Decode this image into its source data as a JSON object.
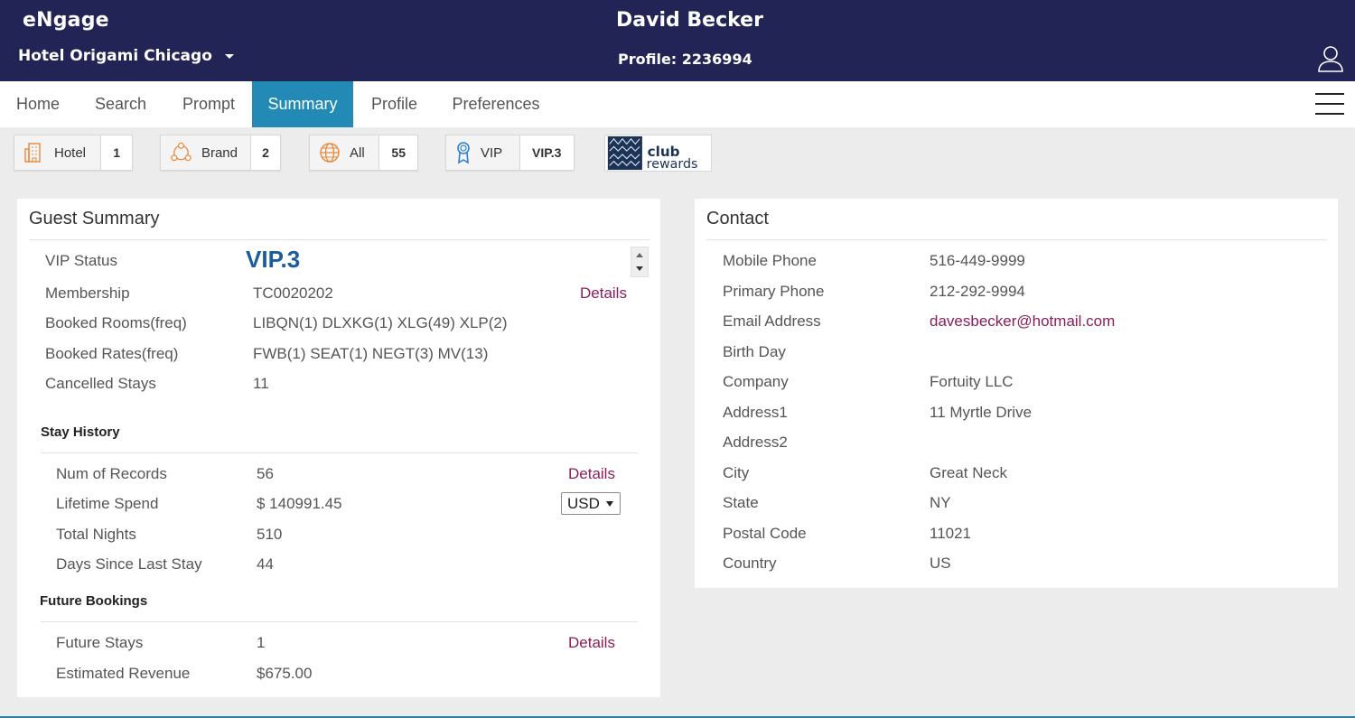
{
  "header": {
    "app_title": "eNgage",
    "hotel": "Hotel Origami Chicago",
    "guest_name": "David Becker",
    "profile": "Profile: 2236994"
  },
  "nav": {
    "tabs": [
      "Home",
      "Search",
      "Prompt",
      "Summary",
      "Profile",
      "Preferences"
    ],
    "active": "Summary"
  },
  "badges": [
    {
      "label": "Hotel",
      "value": "1",
      "icon": "hotel-building-icon"
    },
    {
      "label": "Brand",
      "value": "2",
      "icon": "brand-network-icon"
    },
    {
      "label": "All",
      "value": "55",
      "icon": "globe-icon"
    },
    {
      "label": "VIP",
      "value": "VIP.3",
      "icon": "ribbon-award-icon"
    }
  ],
  "club_logo": {
    "line1": "club",
    "line2": "rewards"
  },
  "guest_summary": {
    "title": "Guest Summary",
    "vip_label": "VIP Status",
    "vip_value": "VIP.3",
    "membership_label": "Membership",
    "membership_value": "TC0020202",
    "details_label": "Details",
    "rooms_label": "Booked Rooms(freq)",
    "rooms_value": "LIBQN(1) DLXKG(1) XLG(49) XLP(2)",
    "rates_label": "Booked Rates(freq)",
    "rates_value": "FWB(1) SEAT(1) NEGT(3) MV(13)",
    "cancelled_label": "Cancelled Stays",
    "cancelled_value": "11"
  },
  "stay_history": {
    "title": "Stay History",
    "records_label": "Num of Records",
    "records_value": "56",
    "details_label": "Details",
    "spend_label": "Lifetime Spend",
    "spend_value": "$ 140991.45",
    "currency": "USD",
    "nights_label": "Total Nights",
    "nights_value": "510",
    "days_label": "Days Since Last Stay",
    "days_value": "44"
  },
  "future_bookings": {
    "title": "Future Bookings",
    "stays_label": "Future Stays",
    "stays_value": "1",
    "details_label": "Details",
    "revenue_label": "Estimated Revenue",
    "revenue_value": "$675.00"
  },
  "contact": {
    "title": "Contact",
    "rows": [
      {
        "label": "Mobile Phone",
        "value": "516-449-9999"
      },
      {
        "label": "Primary Phone",
        "value": "212-292-9994"
      },
      {
        "label": "Email Address",
        "value": "davesbecker@hotmail.com"
      },
      {
        "label": "Birth Day",
        "value": ""
      },
      {
        "label": "Company",
        "value": "Fortuity LLC"
      },
      {
        "label": "Address1",
        "value": "11 Myrtle Drive"
      },
      {
        "label": "Address2",
        "value": ""
      },
      {
        "label": "City",
        "value": "Great Neck"
      },
      {
        "label": "State",
        "value": "NY"
      },
      {
        "label": "Postal Code",
        "value": "11021"
      },
      {
        "label": "Country",
        "value": "US"
      }
    ]
  },
  "colors": {
    "header_bg": "#232456",
    "active_tab": "#2389b5",
    "link": "#8b1d5a",
    "vip": "#1a5c9e"
  }
}
